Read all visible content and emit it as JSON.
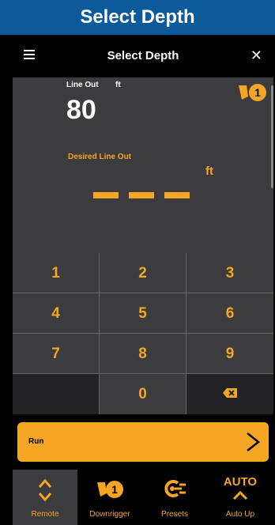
{
  "banner": {
    "title": "Select Depth"
  },
  "nav": {
    "title": "Select Depth",
    "close_glyph": "✕",
    "menu_icon": "hamburger-menu-icon"
  },
  "display": {
    "line_out_label": "Line Out",
    "line_out_unit": "ft",
    "line_out_value": "80",
    "downrigger_badge": "1",
    "desired_label": "Desired Line Out",
    "desired_unit": "ft",
    "desired_placeholder": "– – –"
  },
  "keypad": {
    "keys": [
      "1",
      "2",
      "3",
      "4",
      "5",
      "6",
      "7",
      "8",
      "9",
      "",
      "0",
      "backspace"
    ]
  },
  "run": {
    "label": "Run",
    "arrow_glyph": ">"
  },
  "tabs": [
    {
      "label": "Remote",
      "icon": "up-down-chevron-icon"
    },
    {
      "label": "Downrigger",
      "icon": "downrigger-1-icon",
      "badge": "1"
    },
    {
      "label": "Presets",
      "icon": "presets-icon"
    },
    {
      "label": "Auto Up",
      "icon": "auto-up-icon",
      "icon_text": "AUTO"
    }
  ],
  "colors": {
    "accent": "#f5a623",
    "banner": "#0d5a9a",
    "panel": "#3c3c3e"
  }
}
